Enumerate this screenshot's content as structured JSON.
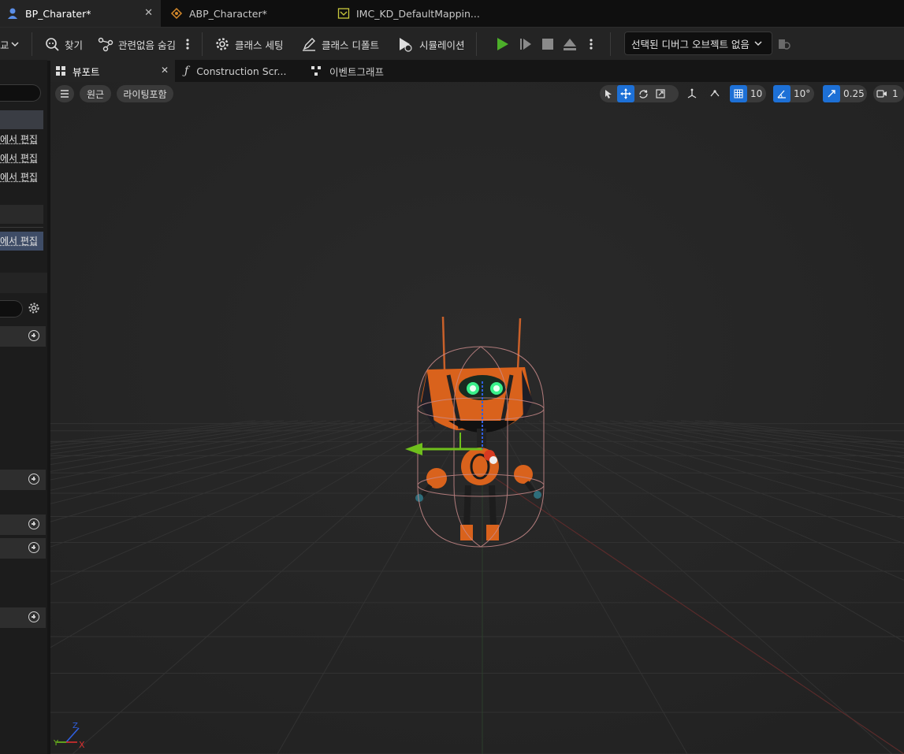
{
  "doc_tabs": [
    {
      "label": "BP_Charater*",
      "icon": "blueprint-person-icon",
      "active": true,
      "closable": true
    },
    {
      "label": "ABP_Character*",
      "icon": "anim-blueprint-icon",
      "active": false
    },
    {
      "label": "IMC_KD_DefaultMappin...",
      "icon": "input-mapping-icon",
      "active": false
    }
  ],
  "toolbar": {
    "compare_fragment": "교",
    "find": "찾기",
    "hide_unrelated": "관련없음 숨김",
    "class_settings": "클래스 세팅",
    "class_defaults": "클래스 디폴트",
    "simulation": "시뮬레이션",
    "debug_object": "선택된 디버그 오브젝트 없음"
  },
  "left_panel": {
    "edit_rows": [
      "에서 편집",
      "에서 편집",
      "에서 편집"
    ],
    "edit_row_selected": "에서 편집"
  },
  "viewport_tabs": [
    {
      "label": "뷰포트",
      "icon": "viewport-icon",
      "active": true
    },
    {
      "label": "Construction Scr...",
      "icon": "function-icon",
      "active": false
    },
    {
      "label": "이벤트그래프",
      "icon": "event-graph-icon",
      "active": false
    }
  ],
  "viewport": {
    "perspective": "원근",
    "lighting": "라이팅포함",
    "grid_snap": "10",
    "rotation_snap": "10°",
    "scale_snap": "0.25",
    "camera_speed": "1",
    "axis_x": "X",
    "axis_y": "Y",
    "axis_z": "Z"
  },
  "colors": {
    "accent": "#1d70d6",
    "play": "#4caf2a",
    "character_orange": "#e0671f",
    "eyes": "#3af08a"
  }
}
